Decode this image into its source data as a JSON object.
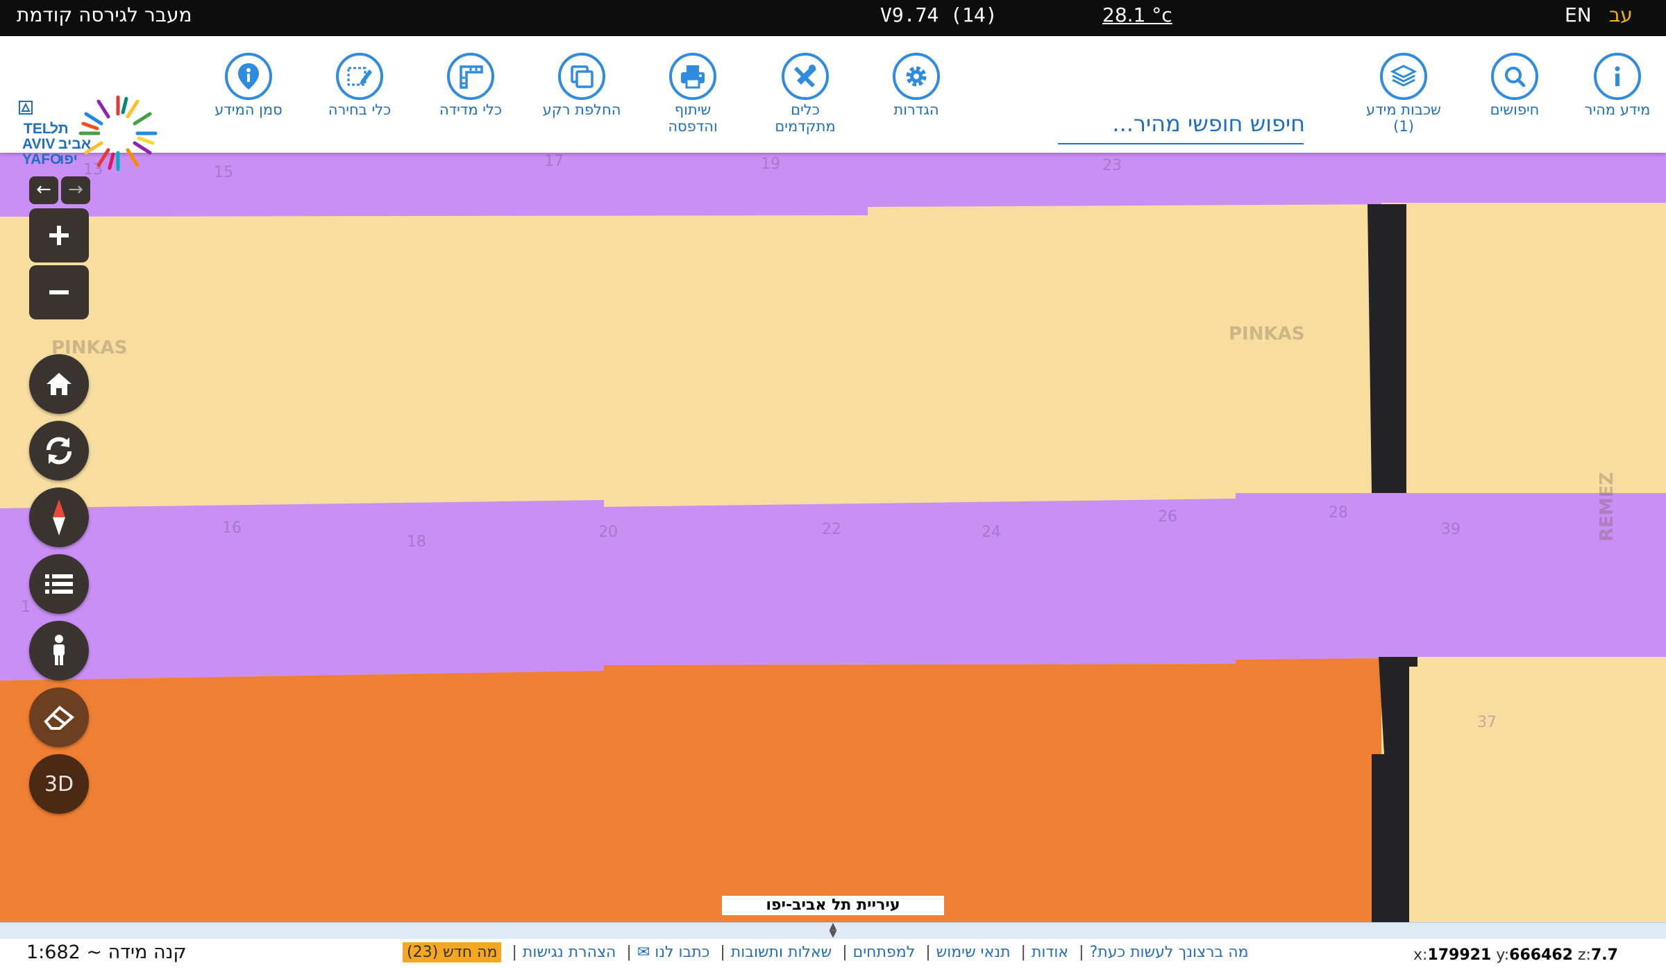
{
  "topbar": {
    "previous_version": "מעבר לגירסה קודמת",
    "version": "V9.74 (14)",
    "temperature": "28.1 °c",
    "lang_en": "EN",
    "lang_he": "עב"
  },
  "toolbar": {
    "quick_info": "מידע מהיר",
    "searches": "חיפושים",
    "layers_line1": "שכבות מידע",
    "layers_line2": "(1)",
    "search_placeholder": "חיפוש חופשי מהיר...",
    "settings": "הגדרות",
    "advanced_tools_line1": "כלים",
    "advanced_tools_line2": "מתקדמים",
    "share_print_line1": "שיתוף",
    "share_print_line2": "והדפסה",
    "basemap": "החלפת רקע",
    "measure": "כלי מדידה",
    "select": "כלי בחירה",
    "info_marker": "סמן המידע",
    "logo_tel": "TEL",
    "logo_aviv": "AVIV",
    "logo_yafo": "YAFO",
    "logo_he1": "תל",
    "logo_he2": "אביב",
    "logo_he3": "יפו"
  },
  "map": {
    "street_pinkas_left": "PINKAS",
    "street_pinkas_right": "PINKAS",
    "street_remez": "REMEZ",
    "lots": [
      "13",
      "15",
      "17",
      "19",
      "23",
      "16",
      "18",
      "20",
      "22",
      "24",
      "26",
      "28",
      "39",
      "37",
      "1"
    ],
    "ctrl_3d": "3D",
    "city_label": "עיריית תל אביב-יפו",
    "colors": {
      "residential": "#f7dda0",
      "public": "#c98ff5",
      "commercial": "#ef8033",
      "road": "#242426"
    }
  },
  "footer": {
    "scale": "קנה מידה ~ 1:682",
    "links": [
      "מה ברצונך לעשות כעת?",
      "אודות",
      "תנאי שימוש",
      "למפתחים",
      "שאלות ותשובות",
      "כתבו לנו ✉",
      "הצהרת נגישות"
    ],
    "whats_new": "מה חדש (23)",
    "x_label": "x:",
    "x": "179921",
    "y_label": "y:",
    "y": "666462",
    "z_label": "z:",
    "z": "7.7"
  }
}
